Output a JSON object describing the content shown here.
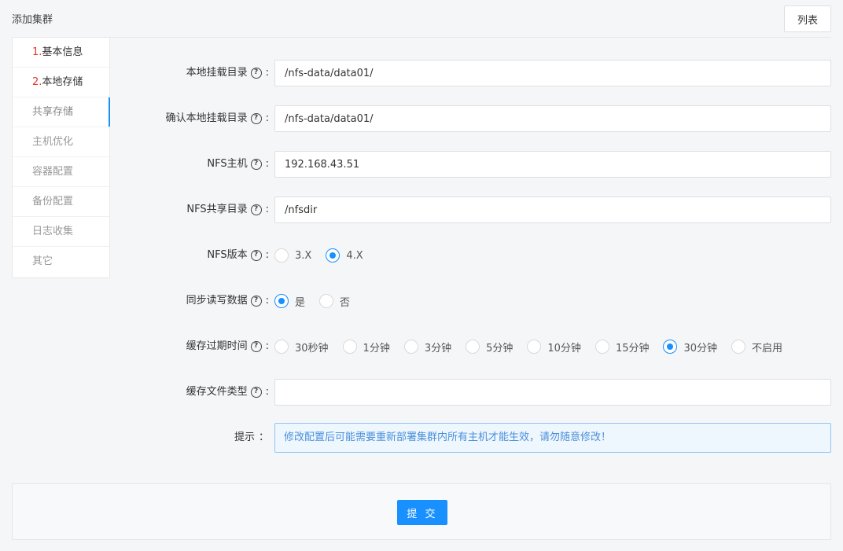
{
  "header": {
    "title": "添加集群",
    "list_button": "列表"
  },
  "steps": [
    {
      "num": "1.",
      "label": "基本信息",
      "state": "done"
    },
    {
      "num": "2.",
      "label": "本地存储",
      "state": "done"
    },
    {
      "num": "",
      "label": "共享存储",
      "state": "active"
    },
    {
      "num": "",
      "label": "主机优化",
      "state": "pending"
    },
    {
      "num": "",
      "label": "容器配置",
      "state": "pending"
    },
    {
      "num": "",
      "label": "备份配置",
      "state": "pending"
    },
    {
      "num": "",
      "label": "日志收集",
      "state": "pending"
    },
    {
      "num": "",
      "label": "其它",
      "state": "pending"
    }
  ],
  "form": {
    "mount_dir": {
      "label": "本地挂载目录",
      "value": "/nfs-data/data01/"
    },
    "confirm_mount_dir": {
      "label": "确认本地挂载目录",
      "value": "/nfs-data/data01/"
    },
    "nfs_host": {
      "label": "NFS主机",
      "value": "192.168.43.51"
    },
    "nfs_share_dir": {
      "label": "NFS共享目录",
      "value": "/nfsdir"
    },
    "nfs_version": {
      "label": "NFS版本",
      "options": [
        "3.X",
        "4.X"
      ],
      "selected": "4.X"
    },
    "sync_rw": {
      "label": "同步读写数据",
      "options": [
        "是",
        "否"
      ],
      "selected": "是"
    },
    "cache_expire": {
      "label": "缓存过期时间",
      "options": [
        "30秒钟",
        "1分钟",
        "3分钟",
        "5分钟",
        "10分钟",
        "15分钟",
        "30分钟",
        "不启用"
      ],
      "selected": "30分钟"
    },
    "cache_file_type": {
      "label": "缓存文件类型",
      "value": ""
    },
    "hint": {
      "label": "提示",
      "text": "修改配置后可能需要重新部署集群内所有主机才能生效，请勿随意修改！"
    }
  },
  "submit_label": "提 交",
  "colors": {
    "primary": "#1890ff",
    "step_num": "#e5382b",
    "hint_bg": "#eef6fe",
    "hint_text": "#4a90d9"
  }
}
